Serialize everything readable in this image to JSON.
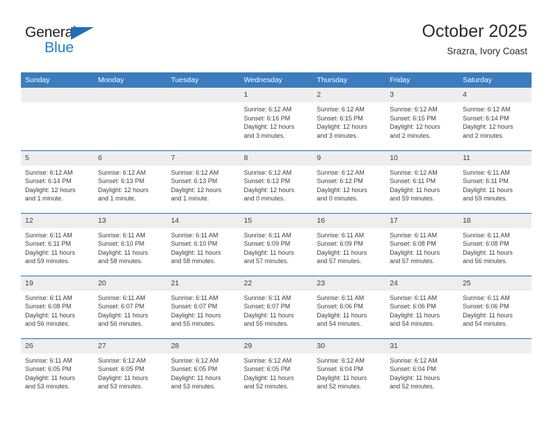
{
  "brand": {
    "name_top": "General",
    "name_bottom": "Blue",
    "triangle_color": "#1f6fb5",
    "blue_text_color": "#1f7ec9",
    "dark_text_color": "#231f20"
  },
  "header": {
    "title": "October 2025",
    "subtitle": "Srazra, Ivory Coast"
  },
  "colors": {
    "header_row_bg": "#3a7cbe",
    "header_row_text": "#ffffff",
    "daynum_bg": "#eeeeee",
    "cell_divider": "#1f6fb5",
    "body_text": "#3c3c3c",
    "page_bg": "#ffffff"
  },
  "weekday_headers": [
    "Sunday",
    "Monday",
    "Tuesday",
    "Wednesday",
    "Thursday",
    "Friday",
    "Saturday"
  ],
  "labels": {
    "sunrise_prefix": "Sunrise:",
    "sunset_prefix": "Sunset:",
    "daylight_prefix": "Daylight:"
  },
  "weeks": [
    [
      {
        "day": "",
        "empty": true,
        "sunrise": "",
        "sunset": "",
        "daylight_line1": "",
        "daylight_line2": ""
      },
      {
        "day": "",
        "empty": true,
        "sunrise": "",
        "sunset": "",
        "daylight_line1": "",
        "daylight_line2": ""
      },
      {
        "day": "",
        "empty": true,
        "sunrise": "",
        "sunset": "",
        "daylight_line1": "",
        "daylight_line2": ""
      },
      {
        "day": "1",
        "empty": false,
        "sunrise": "Sunrise: 6:12 AM",
        "sunset": "Sunset: 6:16 PM",
        "daylight_line1": "Daylight: 12 hours",
        "daylight_line2": "and 3 minutes."
      },
      {
        "day": "2",
        "empty": false,
        "sunrise": "Sunrise: 6:12 AM",
        "sunset": "Sunset: 6:15 PM",
        "daylight_line1": "Daylight: 12 hours",
        "daylight_line2": "and 3 minutes."
      },
      {
        "day": "3",
        "empty": false,
        "sunrise": "Sunrise: 6:12 AM",
        "sunset": "Sunset: 6:15 PM",
        "daylight_line1": "Daylight: 12 hours",
        "daylight_line2": "and 2 minutes."
      },
      {
        "day": "4",
        "empty": false,
        "sunrise": "Sunrise: 6:12 AM",
        "sunset": "Sunset: 6:14 PM",
        "daylight_line1": "Daylight: 12 hours",
        "daylight_line2": "and 2 minutes."
      }
    ],
    [
      {
        "day": "5",
        "empty": false,
        "sunrise": "Sunrise: 6:12 AM",
        "sunset": "Sunset: 6:14 PM",
        "daylight_line1": "Daylight: 12 hours",
        "daylight_line2": "and 1 minute."
      },
      {
        "day": "6",
        "empty": false,
        "sunrise": "Sunrise: 6:12 AM",
        "sunset": "Sunset: 6:13 PM",
        "daylight_line1": "Daylight: 12 hours",
        "daylight_line2": "and 1 minute."
      },
      {
        "day": "7",
        "empty": false,
        "sunrise": "Sunrise: 6:12 AM",
        "sunset": "Sunset: 6:13 PM",
        "daylight_line1": "Daylight: 12 hours",
        "daylight_line2": "and 1 minute."
      },
      {
        "day": "8",
        "empty": false,
        "sunrise": "Sunrise: 6:12 AM",
        "sunset": "Sunset: 6:12 PM",
        "daylight_line1": "Daylight: 12 hours",
        "daylight_line2": "and 0 minutes."
      },
      {
        "day": "9",
        "empty": false,
        "sunrise": "Sunrise: 6:12 AM",
        "sunset": "Sunset: 6:12 PM",
        "daylight_line1": "Daylight: 12 hours",
        "daylight_line2": "and 0 minutes."
      },
      {
        "day": "10",
        "empty": false,
        "sunrise": "Sunrise: 6:12 AM",
        "sunset": "Sunset: 6:11 PM",
        "daylight_line1": "Daylight: 11 hours",
        "daylight_line2": "and 59 minutes."
      },
      {
        "day": "11",
        "empty": false,
        "sunrise": "Sunrise: 6:11 AM",
        "sunset": "Sunset: 6:11 PM",
        "daylight_line1": "Daylight: 11 hours",
        "daylight_line2": "and 59 minutes."
      }
    ],
    [
      {
        "day": "12",
        "empty": false,
        "sunrise": "Sunrise: 6:11 AM",
        "sunset": "Sunset: 6:11 PM",
        "daylight_line1": "Daylight: 11 hours",
        "daylight_line2": "and 59 minutes."
      },
      {
        "day": "13",
        "empty": false,
        "sunrise": "Sunrise: 6:11 AM",
        "sunset": "Sunset: 6:10 PM",
        "daylight_line1": "Daylight: 11 hours",
        "daylight_line2": "and 58 minutes."
      },
      {
        "day": "14",
        "empty": false,
        "sunrise": "Sunrise: 6:11 AM",
        "sunset": "Sunset: 6:10 PM",
        "daylight_line1": "Daylight: 11 hours",
        "daylight_line2": "and 58 minutes."
      },
      {
        "day": "15",
        "empty": false,
        "sunrise": "Sunrise: 6:11 AM",
        "sunset": "Sunset: 6:09 PM",
        "daylight_line1": "Daylight: 11 hours",
        "daylight_line2": "and 57 minutes."
      },
      {
        "day": "16",
        "empty": false,
        "sunrise": "Sunrise: 6:11 AM",
        "sunset": "Sunset: 6:09 PM",
        "daylight_line1": "Daylight: 11 hours",
        "daylight_line2": "and 57 minutes."
      },
      {
        "day": "17",
        "empty": false,
        "sunrise": "Sunrise: 6:11 AM",
        "sunset": "Sunset: 6:08 PM",
        "daylight_line1": "Daylight: 11 hours",
        "daylight_line2": "and 57 minutes."
      },
      {
        "day": "18",
        "empty": false,
        "sunrise": "Sunrise: 6:11 AM",
        "sunset": "Sunset: 6:08 PM",
        "daylight_line1": "Daylight: 11 hours",
        "daylight_line2": "and 56 minutes."
      }
    ],
    [
      {
        "day": "19",
        "empty": false,
        "sunrise": "Sunrise: 6:11 AM",
        "sunset": "Sunset: 6:08 PM",
        "daylight_line1": "Daylight: 11 hours",
        "daylight_line2": "and 56 minutes."
      },
      {
        "day": "20",
        "empty": false,
        "sunrise": "Sunrise: 6:11 AM",
        "sunset": "Sunset: 6:07 PM",
        "daylight_line1": "Daylight: 11 hours",
        "daylight_line2": "and 56 minutes."
      },
      {
        "day": "21",
        "empty": false,
        "sunrise": "Sunrise: 6:11 AM",
        "sunset": "Sunset: 6:07 PM",
        "daylight_line1": "Daylight: 11 hours",
        "daylight_line2": "and 55 minutes."
      },
      {
        "day": "22",
        "empty": false,
        "sunrise": "Sunrise: 6:11 AM",
        "sunset": "Sunset: 6:07 PM",
        "daylight_line1": "Daylight: 11 hours",
        "daylight_line2": "and 55 minutes."
      },
      {
        "day": "23",
        "empty": false,
        "sunrise": "Sunrise: 6:11 AM",
        "sunset": "Sunset: 6:06 PM",
        "daylight_line1": "Daylight: 11 hours",
        "daylight_line2": "and 54 minutes."
      },
      {
        "day": "24",
        "empty": false,
        "sunrise": "Sunrise: 6:11 AM",
        "sunset": "Sunset: 6:06 PM",
        "daylight_line1": "Daylight: 11 hours",
        "daylight_line2": "and 54 minutes."
      },
      {
        "day": "25",
        "empty": false,
        "sunrise": "Sunrise: 6:11 AM",
        "sunset": "Sunset: 6:06 PM",
        "daylight_line1": "Daylight: 11 hours",
        "daylight_line2": "and 54 minutes."
      }
    ],
    [
      {
        "day": "26",
        "empty": false,
        "sunrise": "Sunrise: 6:11 AM",
        "sunset": "Sunset: 6:05 PM",
        "daylight_line1": "Daylight: 11 hours",
        "daylight_line2": "and 53 minutes."
      },
      {
        "day": "27",
        "empty": false,
        "sunrise": "Sunrise: 6:12 AM",
        "sunset": "Sunset: 6:05 PM",
        "daylight_line1": "Daylight: 11 hours",
        "daylight_line2": "and 53 minutes."
      },
      {
        "day": "28",
        "empty": false,
        "sunrise": "Sunrise: 6:12 AM",
        "sunset": "Sunset: 6:05 PM",
        "daylight_line1": "Daylight: 11 hours",
        "daylight_line2": "and 53 minutes."
      },
      {
        "day": "29",
        "empty": false,
        "sunrise": "Sunrise: 6:12 AM",
        "sunset": "Sunset: 6:05 PM",
        "daylight_line1": "Daylight: 11 hours",
        "daylight_line2": "and 52 minutes."
      },
      {
        "day": "30",
        "empty": false,
        "sunrise": "Sunrise: 6:12 AM",
        "sunset": "Sunset: 6:04 PM",
        "daylight_line1": "Daylight: 11 hours",
        "daylight_line2": "and 52 minutes."
      },
      {
        "day": "31",
        "empty": false,
        "sunrise": "Sunrise: 6:12 AM",
        "sunset": "Sunset: 6:04 PM",
        "daylight_line1": "Daylight: 11 hours",
        "daylight_line2": "and 52 minutes."
      },
      {
        "day": "",
        "empty": true,
        "sunrise": "",
        "sunset": "",
        "daylight_line1": "",
        "daylight_line2": ""
      }
    ]
  ]
}
